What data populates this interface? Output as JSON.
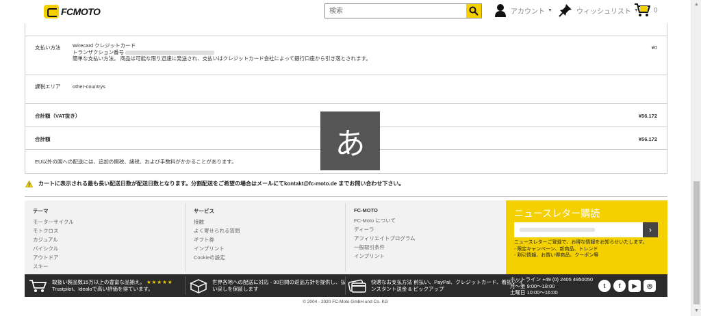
{
  "header": {
    "logo": "FCMOTO",
    "search_placeholder": "検索",
    "account_label": "アカウント",
    "wishlist_label": "ウィッシュリスト",
    "cart_count": "0"
  },
  "summary": {
    "payment": {
      "label": "支払い方法",
      "method": "Wirecard クレジットカード",
      "transaction_label": "トランザクション番号",
      "description": "簡単な支払い方法。 商品は可能な限り迅速に発送され、支払いはクレジットカード会社によって銀行口座から引き落とされます。",
      "amount": "¥0"
    },
    "tax_area": {
      "label": "課税エリア",
      "value": "other-countrys"
    },
    "total_excl_vat": {
      "label": "合計額（VAT抜き）",
      "amount": "¥56.172"
    },
    "total": {
      "label": "合計額",
      "amount": "¥56.172"
    },
    "customs_note": "EU以外の国への配送には、追加の関税、諸税、および手数料がかかることがあります。"
  },
  "ime_indicator": "あ",
  "delivery_warning": "カートに表示される最も長い配送日数が配送日数となります。分割配送をご希望の場合はメールにてkontakt@fc-moto.de までお問い合わせ下さい。",
  "footer": {
    "columns": [
      {
        "title": "テーマ",
        "items": [
          "モーターサイクル",
          "モトクロス",
          "カジュアル",
          "バイシクル",
          "アウトドア",
          "スキー"
        ]
      },
      {
        "title": "サービス",
        "items": [
          "接触",
          "よく寄せられる質問",
          "ギフト券",
          "インプリント",
          "Cookieの設定"
        ]
      },
      {
        "title": "FC-MOTO",
        "items": [
          "FC-Moto について",
          "ディーラ",
          "アフィリエイトプログラム",
          "一般取引条件",
          "インプリント"
        ]
      }
    ],
    "newsletter": {
      "title": "ニュースレター購読",
      "button": "›",
      "text_1": "ニュースレターご登録で、お得な情報をお知らせいたします。",
      "text_2": "- 限定キャンペーン、新商品、トレンド",
      "text_3": "- 割引情報、お買い得商品、クーポン等"
    }
  },
  "bar": {
    "assortment_1": "取扱い製品数15万以上の豊富な品揃え。",
    "stars": "★★★★★",
    "assortment_2": "Trustpilot、Idealoで高い評価を得ています。",
    "shipping": "世界各地への配送に対応 - 30日間の返品方針を提供し、払い戻しを保証します",
    "payment": "快適なお支払方法 前払い、PayPal、クレジットカード、着払い インスタント送金 & ピックアップ",
    "hotline": "ホットライン +49 (0) 2405 4950050",
    "hours_weekday": "月〜金 9:00〜18:00",
    "hours_saturday": "土曜日 10:00〜16:00",
    "social": [
      "twitter-icon",
      "facebook-icon",
      "youtube-icon",
      "instagram-icon"
    ]
  },
  "copyright": "© 2004 - 2020 FC-Moto GmbH und Co. KG",
  "colors": {
    "accent": "#f4d000",
    "dark": "#2b2b2b"
  }
}
